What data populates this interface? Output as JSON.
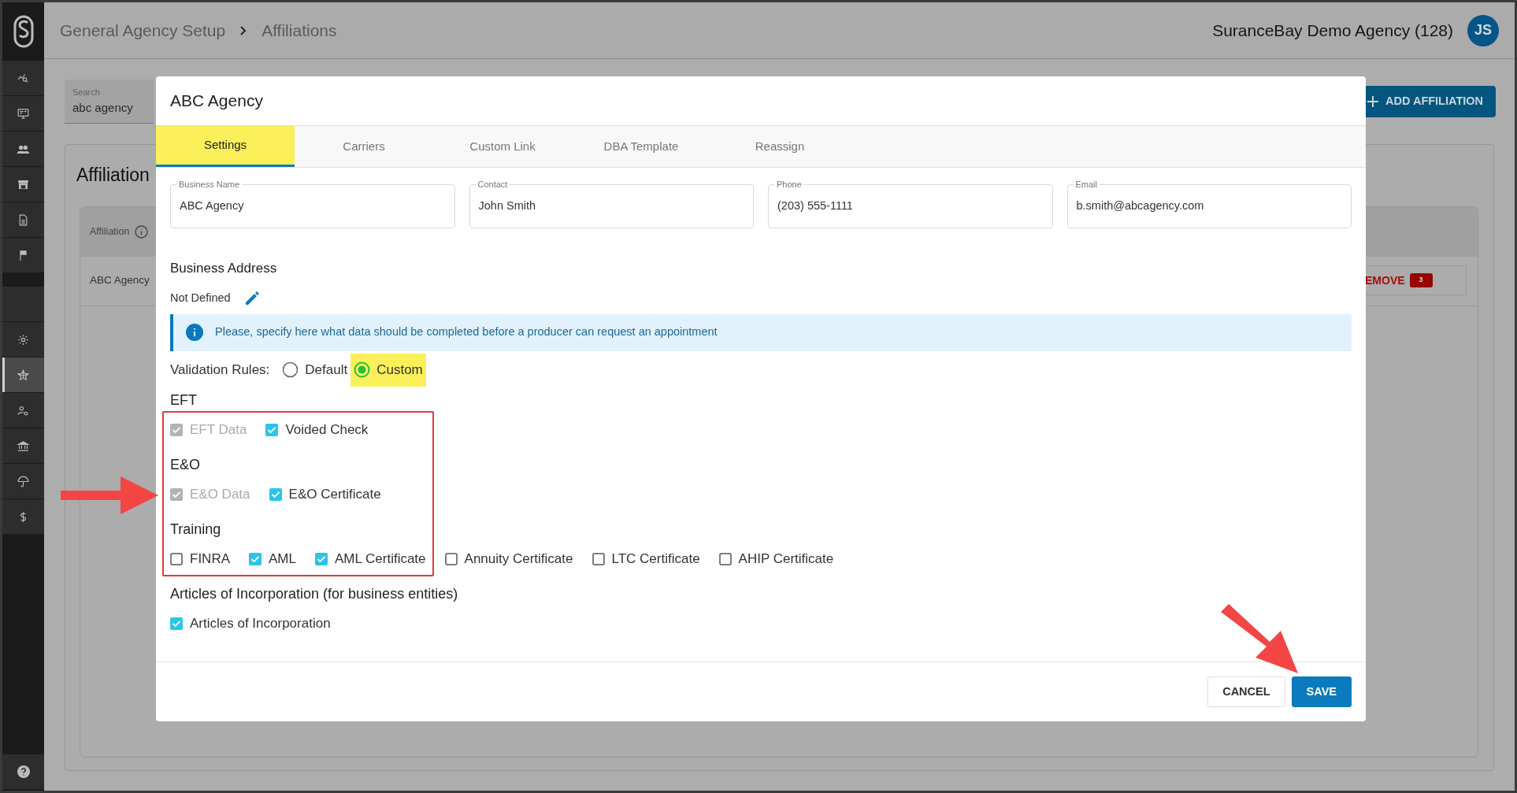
{
  "sidebar": {
    "items": [
      {
        "kind": "chart",
        "selected": false
      },
      {
        "kind": "monitor",
        "selected": false
      },
      {
        "kind": "people",
        "selected": false
      },
      {
        "kind": "store",
        "selected": false
      },
      {
        "kind": "document",
        "selected": false
      },
      {
        "kind": "flag",
        "selected": false
      },
      {
        "kind": "blank",
        "selected": false
      },
      {
        "kind": "gear",
        "selected": false
      },
      {
        "kind": "star",
        "selected": true
      },
      {
        "kind": "user-gear",
        "selected": false
      },
      {
        "kind": "bank",
        "selected": false
      },
      {
        "kind": "umbrella",
        "selected": false
      },
      {
        "kind": "dollar",
        "selected": false
      }
    ]
  },
  "header": {
    "breadcrumb": [
      "General Agency Setup",
      "Affiliations"
    ],
    "agency": "SuranceBay Demo Agency (128)",
    "avatar": "JS"
  },
  "background": {
    "search": {
      "label": "Search",
      "value": "abc agency"
    },
    "add_button": "ADD AFFILIATION",
    "section_title": "Affiliation",
    "column_1": "Affiliation",
    "row_cell": "ABC Agency",
    "remove_button": "EMOVE",
    "remove_count": "3"
  },
  "dialog": {
    "title": "ABC Agency",
    "tabs": [
      {
        "label": "Settings",
        "selected": true,
        "highlighted": true
      },
      {
        "label": "Carriers",
        "selected": false,
        "highlighted": false
      },
      {
        "label": "Custom Link",
        "selected": false,
        "highlighted": false
      },
      {
        "label": "DBA Template",
        "selected": false,
        "highlighted": false
      },
      {
        "label": "Reassign",
        "selected": false,
        "highlighted": false
      }
    ],
    "fields": [
      {
        "label": "Business Name",
        "value": "ABC Agency"
      },
      {
        "label": "Contact",
        "value": "John Smith"
      },
      {
        "label": "Phone",
        "value": "(203) 555-1111"
      },
      {
        "label": "Email",
        "value": "b.smith@abcagency.com"
      }
    ],
    "address_title": "Business Address",
    "address_value": "Not Defined",
    "info": "Please, specify here what data should be completed before a producer can request an appointment",
    "validation": {
      "label": "Validation Rules:",
      "options": [
        {
          "label": "Default",
          "selected": false,
          "highlighted": false
        },
        {
          "label": "Custom",
          "selected": true,
          "highlighted": true
        }
      ]
    },
    "groups": [
      {
        "title": "EFT",
        "items": [
          {
            "label": "EFT Data",
            "checked": true,
            "disabled": true
          },
          {
            "label": "Voided Check",
            "checked": true,
            "disabled": false
          }
        ]
      },
      {
        "title": "E&O",
        "items": [
          {
            "label": "E&O Data",
            "checked": true,
            "disabled": true
          },
          {
            "label": "E&O Certificate",
            "checked": true,
            "disabled": false
          }
        ]
      },
      {
        "title": "Training",
        "items": [
          {
            "label": "FINRA",
            "checked": false,
            "disabled": false
          },
          {
            "label": "AML",
            "checked": true,
            "disabled": false
          },
          {
            "label": "AML Certificate",
            "checked": true,
            "disabled": false
          },
          {
            "label": "Annuity Certificate",
            "checked": false,
            "disabled": false
          },
          {
            "label": "LTC Certificate",
            "checked": false,
            "disabled": false
          },
          {
            "label": "AHIP Certificate",
            "checked": false,
            "disabled": false
          }
        ]
      },
      {
        "title": "Articles of Incorporation (for business entities)",
        "items": [
          {
            "label": "Articles of Incorporation",
            "checked": true,
            "disabled": false
          }
        ]
      }
    ],
    "buttons": [
      {
        "label": "CANCEL",
        "kind": "secondary"
      },
      {
        "label": "SAVE",
        "kind": "primary"
      }
    ]
  },
  "annotations": [
    {
      "kind": "frame"
    },
    {
      "kind": "arrow-right"
    },
    {
      "kind": "arrow-down-right"
    }
  ]
}
